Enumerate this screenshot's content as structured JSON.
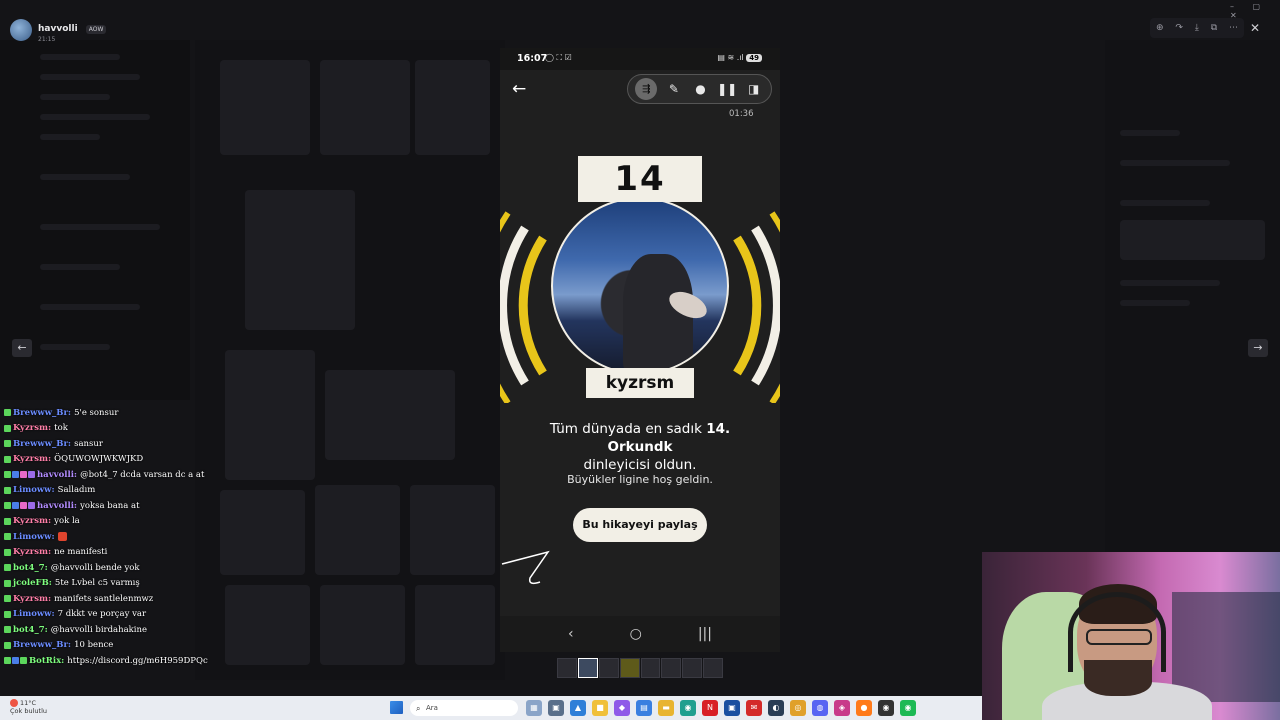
{
  "viewer": {
    "user_name": "havvolli",
    "user_badge": "AOW",
    "user_time": "21:15",
    "tools": [
      "zoom-icon",
      "forward-icon",
      "download-icon",
      "external-icon",
      "more-icon"
    ],
    "close_glyph": "✕",
    "prev_glyph": "←",
    "next_glyph": "→",
    "window_controls": "– ▢ ✕"
  },
  "chat": {
    "messages": [
      {
        "user": "Brewww_Br:",
        "text": "5'e sonsur",
        "color": "#6b8cff",
        "badges": [
          "green"
        ]
      },
      {
        "user": "Kyzrsm:",
        "text": "tok",
        "color": "#ff7fa8",
        "badges": [
          "green"
        ]
      },
      {
        "user": "Brewww_Br:",
        "text": "sansur",
        "color": "#6b8cff",
        "badges": [
          "green"
        ]
      },
      {
        "user": "Kyzrsm:",
        "text": "ÖQUWOWJWKWJKD",
        "color": "#ff7fa8",
        "badges": [
          "green"
        ]
      },
      {
        "user": "havvolli:",
        "text": "@bot4_7 dcda varsan dc a at",
        "color": "#b38cff",
        "badges": [
          "green",
          "blue",
          "pink",
          "purp"
        ]
      },
      {
        "user": "Limoww:",
        "text": "Salladım",
        "color": "#6b8cff",
        "badges": [
          "green"
        ]
      },
      {
        "user": "havvolli:",
        "text": "yoksa bana at",
        "color": "#b38cff",
        "badges": [
          "green",
          "blue",
          "pink",
          "purp"
        ]
      },
      {
        "user": "Kyzrsm:",
        "text": "yok la",
        "color": "#ff7fa8",
        "badges": [
          "green"
        ]
      },
      {
        "user": "Limoww:",
        "text": "",
        "color": "#6b8cff",
        "badges": [
          "green"
        ],
        "emote": true
      },
      {
        "user": "Kyzrsm:",
        "text": "ne manifesti",
        "color": "#ff7fa8",
        "badges": [
          "green"
        ]
      },
      {
        "user": "bot4_7:",
        "text": "@havvolli bende yok",
        "color": "#7fff7f",
        "badges": [
          "green"
        ]
      },
      {
        "user": "jcoleFB:",
        "text": "5te Lvbel c5 varmış",
        "color": "#7fff7f",
        "badges": [
          "green"
        ]
      },
      {
        "user": "Kyzrsm:",
        "text": "manifets santlelenmwz",
        "color": "#ff7fa8",
        "badges": [
          "green"
        ]
      },
      {
        "user": "Limoww:",
        "text": "7 dkkt ve porçay var",
        "color": "#6b8cff",
        "badges": [
          "green"
        ]
      },
      {
        "user": "bot4_7:",
        "text": "@havvolli birdahakine",
        "color": "#7fff7f",
        "badges": [
          "green"
        ]
      },
      {
        "user": "Brewww_Br:",
        "text": "10 bence",
        "color": "#6b8cff",
        "badges": [
          "green"
        ]
      },
      {
        "user": "BotRix:",
        "text": "https://discord.gg/m6H959DPQc",
        "color": "#7fff7f",
        "badges": [
          "green",
          "blue",
          "green"
        ]
      }
    ]
  },
  "phone": {
    "status_time": "16:07",
    "status_icons": "◯ ⛶ ☑",
    "status_right": "▤ ≋ .ıl",
    "battery": "49",
    "back_glyph": "←",
    "controls": [
      "record-icon",
      "pen-icon",
      "person-icon",
      "pause-icon",
      "mute-icon"
    ],
    "rec_time": "01:36",
    "rank": "14",
    "artist_name": "kyzrsm",
    "headline_pre": "Tüm dünyada en sadık ",
    "headline_rank": "14. Orkundk",
    "headline_post": "dinleyicisi oldun.",
    "subtext": "Büyükler ligine hoş geldin.",
    "share_label": "Bu hikayeyi paylaş",
    "nav": [
      "‹",
      "○",
      "|||"
    ]
  },
  "thumbs_count": 8,
  "taskbar": {
    "weather_temp": "11°C",
    "weather_desc": "Çok bulutlu",
    "search_placeholder": "Ara",
    "icons": [
      {
        "name": "widget-icon",
        "color": "#8aa4c8",
        "glyph": "▦"
      },
      {
        "name": "taskview-icon",
        "color": "#5a6f8a",
        "glyph": "▣"
      },
      {
        "name": "photos-icon",
        "color": "#2f7fd8",
        "glyph": "▲"
      },
      {
        "name": "files-icon",
        "color": "#f0c03a",
        "glyph": "■"
      },
      {
        "name": "copilot-icon",
        "color": "#8f5ae8",
        "glyph": "◆"
      },
      {
        "name": "store-icon",
        "color": "#3a7fe0",
        "glyph": "▤"
      },
      {
        "name": "folder-icon",
        "color": "#e8b430",
        "glyph": "▬"
      },
      {
        "name": "edge-icon",
        "color": "#1f9f8f",
        "glyph": "◉"
      },
      {
        "name": "netflix-icon",
        "color": "#d81f26",
        "glyph": "N"
      },
      {
        "name": "app-icon",
        "color": "#1a4fa0",
        "glyph": "▣"
      },
      {
        "name": "mail-icon",
        "color": "#d42a2a",
        "glyph": "✉"
      },
      {
        "name": "obs-icon",
        "color": "#2a3d55",
        "glyph": "◐"
      },
      {
        "name": "chrome-icon",
        "color": "#e0a02a",
        "glyph": "◎"
      },
      {
        "name": "discord-icon",
        "color": "#5865f2",
        "glyph": "◍"
      },
      {
        "name": "game-icon",
        "color": "#c83a8a",
        "glyph": "◈"
      },
      {
        "name": "firefox-icon",
        "color": "#ff7a1a",
        "glyph": "●"
      },
      {
        "name": "misc-icon",
        "color": "#333333",
        "glyph": "◉"
      },
      {
        "name": "spotify-icon",
        "color": "#1db954",
        "glyph": "◉"
      }
    ]
  },
  "colors": {
    "story_yellow": "#e8c51a",
    "story_cream": "#f2efe6",
    "phone_bg": "#1f1f1f"
  }
}
